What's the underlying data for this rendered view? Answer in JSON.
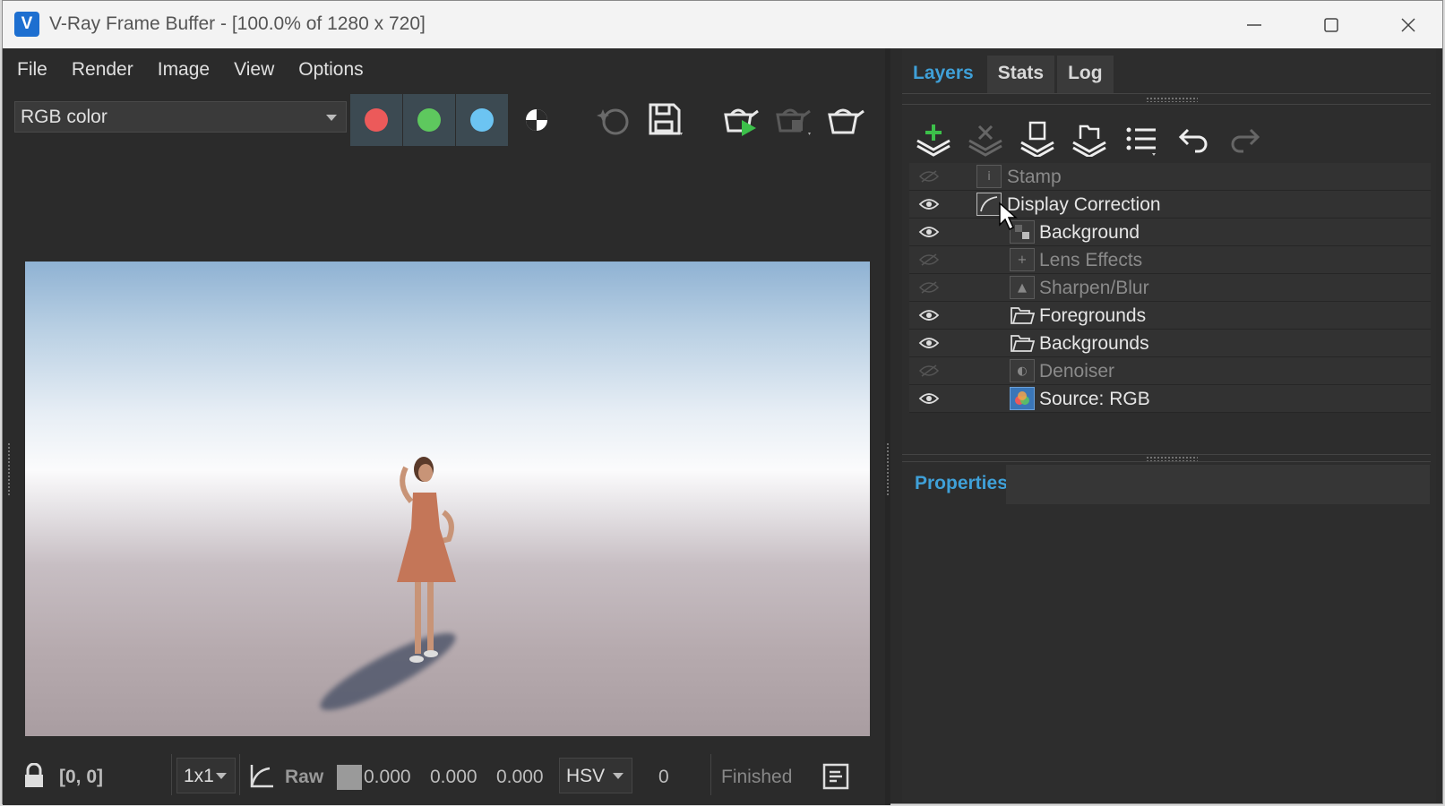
{
  "window": {
    "logo": "V",
    "title": "V-Ray Frame Buffer - [100.0% of 1280 x 720]",
    "controls": [
      "minimize-icon",
      "maximize-icon",
      "close-icon"
    ]
  },
  "menu": [
    "File",
    "Render",
    "Image",
    "View",
    "Options"
  ],
  "toolbar": {
    "channel": "RGB color",
    "channel_colors": {
      "red": "#ec5a5a",
      "green": "#5ec85e",
      "blue": "#6cc4f2"
    },
    "icons": [
      "alpha-toggle-icon",
      "lens-effects-icon",
      "save-icon",
      "render-teapot-icon",
      "interactive-teapot-icon",
      "stop-teapot-icon"
    ]
  },
  "status": {
    "coords": "[0, 0]",
    "sampling": "1x1",
    "raw_label": "Raw",
    "v1": "0.000",
    "v2": "0.000",
    "v3": "0.000",
    "color_mode": "HSV",
    "count": "0",
    "state": "Finished"
  },
  "tabs": [
    "Layers",
    "Stats",
    "Log"
  ],
  "layers": [
    {
      "name": "Stamp",
      "visible": false,
      "icon": "stamp-icon"
    },
    {
      "name": "Display Correction",
      "visible": true,
      "icon": "curve-icon"
    },
    {
      "name": "Background",
      "visible": true,
      "icon": "background-icon"
    },
    {
      "name": "Lens Effects",
      "visible": false,
      "icon": "lens-effects-icon"
    },
    {
      "name": "Sharpen/Blur",
      "visible": false,
      "icon": "sharpen-icon"
    },
    {
      "name": "Foregrounds",
      "visible": true,
      "icon": "folder-icon"
    },
    {
      "name": "Backgrounds",
      "visible": true,
      "icon": "folder-icon"
    },
    {
      "name": "Denoiser",
      "visible": false,
      "icon": "denoiser-icon"
    },
    {
      "name": "Source: RGB",
      "visible": true,
      "icon": "source-rgb-icon"
    }
  ],
  "properties_title": "Properties",
  "accent": "#3fa0d8"
}
